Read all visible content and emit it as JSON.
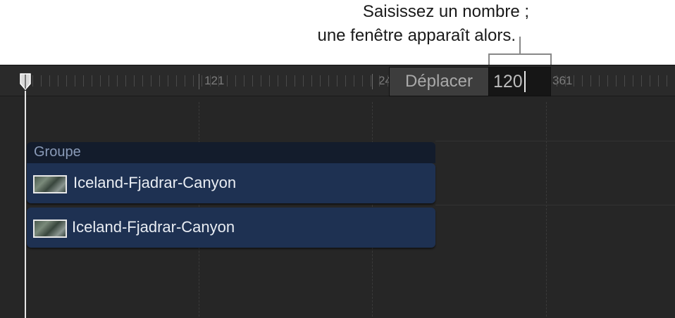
{
  "callout": {
    "line1": "Saisissez un nombre ;",
    "line2": "une fenêtre apparaît alors."
  },
  "ruler": {
    "labels": [
      {
        "text": "121"
      },
      {
        "text": "24"
      },
      {
        "text": "361"
      }
    ]
  },
  "move_field": {
    "label": "Déplacer",
    "value": "120"
  },
  "group": {
    "label": "Groupe"
  },
  "clips": [
    {
      "label": "Iceland-Fjadrar-Canyon"
    },
    {
      "label": "Iceland-Fjadrar-Canyon"
    }
  ],
  "colors": {
    "background": "#262626",
    "clip": "#1e3152",
    "group": "#131c2c",
    "playhead": "#e6e6e6"
  }
}
